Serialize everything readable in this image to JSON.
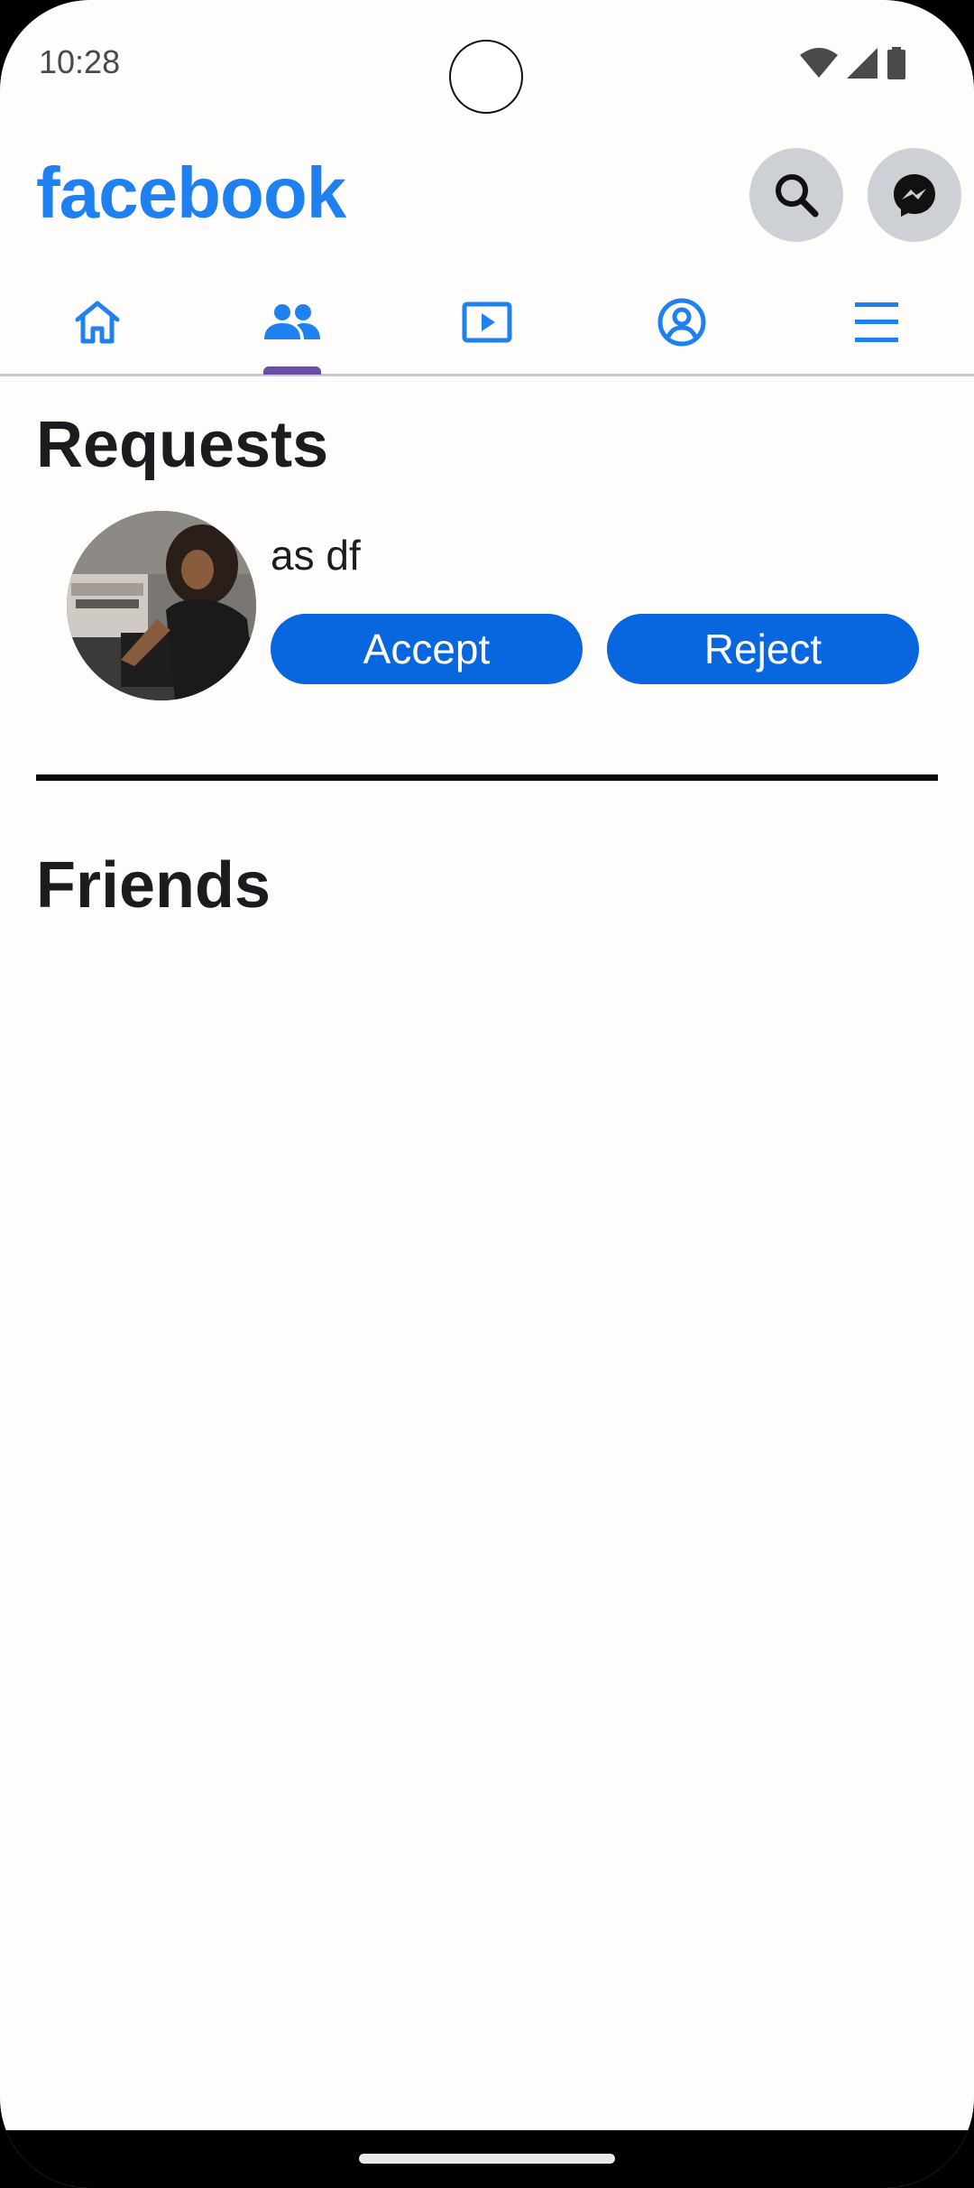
{
  "status_bar": {
    "time": "10:28",
    "icons": [
      "wifi-icon",
      "cellular-icon",
      "battery-icon"
    ]
  },
  "header": {
    "brand": "facebook",
    "actions": [
      "search-icon",
      "messenger-icon"
    ]
  },
  "tabs": [
    {
      "name": "home",
      "icon": "home-icon",
      "selected": false
    },
    {
      "name": "friends",
      "icon": "friends-icon",
      "selected": true
    },
    {
      "name": "watch",
      "icon": "video-icon",
      "selected": false
    },
    {
      "name": "profile",
      "icon": "profile-icon",
      "selected": false
    },
    {
      "name": "menu",
      "icon": "menu-icon",
      "selected": false
    }
  ],
  "requests": {
    "title": "Requests",
    "items": [
      {
        "name": "as df",
        "accept_label": "Accept",
        "reject_label": "Reject"
      }
    ]
  },
  "friends": {
    "title": "Friends"
  },
  "colors": {
    "brand": "#1f80f0",
    "button": "#0866de",
    "tab_indicator": "#6a4fa3",
    "title_text": "#1d1b20"
  }
}
